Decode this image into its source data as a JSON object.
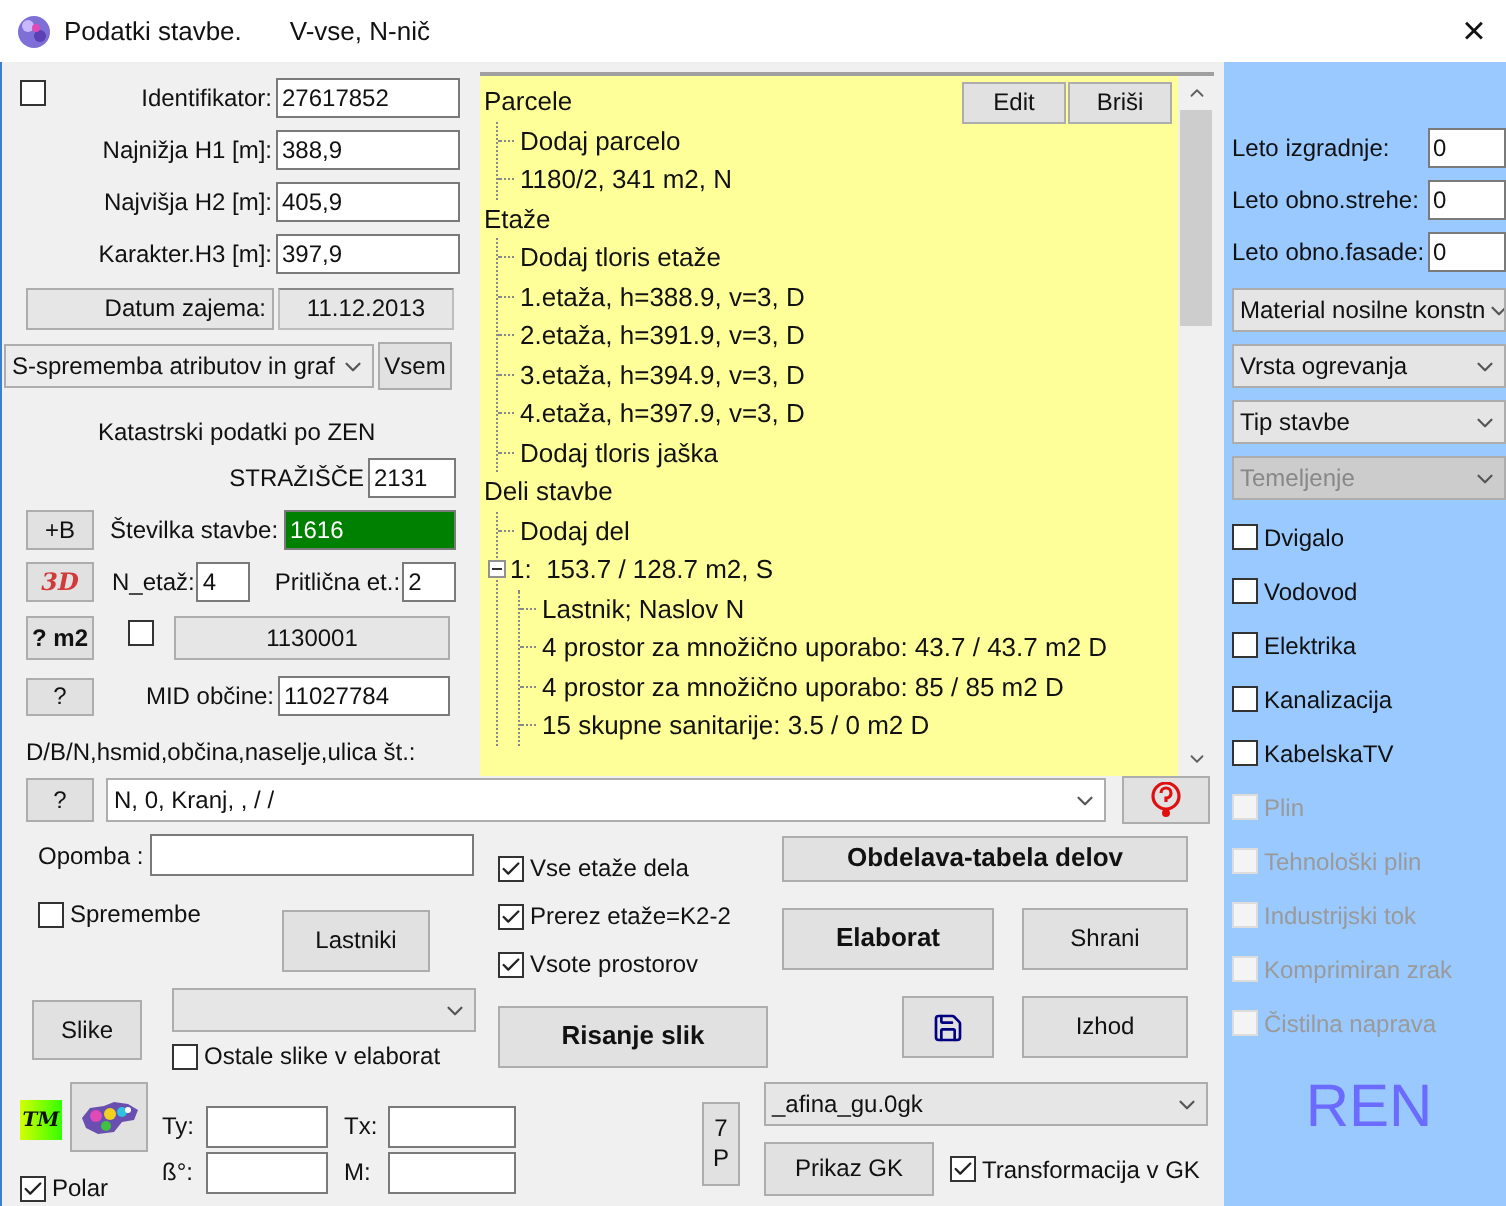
{
  "window": {
    "title": "Podatki stavbe.",
    "subtitle": "V-vse, N-nič",
    "close": "×"
  },
  "identifier": {
    "checked": false,
    "label": "Identifikator:",
    "value": "27617852"
  },
  "heights": [
    {
      "label": "Najnižja H1 [m]:",
      "value": "388,9"
    },
    {
      "label": "Najvišja H2 [m]:",
      "value": "405,9"
    },
    {
      "label": "Karakter.H3 [m]:",
      "value": "397,9"
    }
  ],
  "capture_date": {
    "button": "Datum zajema:",
    "value": "11.12.2013"
  },
  "change_mode": {
    "value": "S-sprememba atributov in graf",
    "button": "Vsem"
  },
  "cadastre": {
    "heading": "Katastrski podatki po ZEN",
    "area_name": "STRAŽIŠČE",
    "area_code": "2131"
  },
  "building_number": {
    "button": "+B",
    "label": "Številka stavbe:",
    "value": "1616"
  },
  "floors": {
    "button": "3D",
    "label": "N_etaž:",
    "value": "4",
    "ground_label": "Pritlična et.:",
    "ground_value": "2"
  },
  "area_row": {
    "button": "? m2",
    "checked": false,
    "code_button": "1130001"
  },
  "municipality": {
    "button": "?",
    "label": "MID občine:",
    "value": "11027784"
  },
  "address_hint": "D/B/N,hsmid,občina,naselje,ulica št.:",
  "address": {
    "button": "?",
    "value": "N, 0, Kranj, , / /"
  },
  "tree": {
    "buttons": [
      "Edit",
      "Briši"
    ],
    "items": [
      {
        "label": "Parcele",
        "children": [
          {
            "label": "Dodaj parcelo"
          },
          {
            "label": "1180/2, 341 m2, N"
          }
        ]
      },
      {
        "label": "Etaže",
        "children": [
          {
            "label": "Dodaj tloris etaže"
          },
          {
            "label": "1.etaža, h=388.9, v=3, D"
          },
          {
            "label": "2.etaža, h=391.9, v=3, D"
          },
          {
            "label": "3.etaža, h=394.9, v=3, D"
          },
          {
            "label": "4.etaža, h=397.9, v=3, D"
          },
          {
            "label": "Dodaj tloris jaška"
          }
        ]
      },
      {
        "label": "Deli stavbe",
        "children": [
          {
            "label": "Dodaj del"
          },
          {
            "label": "1:  153.7 / 128.7 m2, S",
            "expanded": true,
            "children": [
              {
                "label": "Lastnik; Naslov N"
              },
              {
                "label": "4 prostor za množično uporabo: 43.7 / 43.7 m2 D"
              },
              {
                "label": "4 prostor za množično uporabo: 85 / 85 m2 D"
              },
              {
                "label": "15 skupne sanitarije: 3.5 / 0 m2 D"
              }
            ]
          }
        ]
      }
    ]
  },
  "note": {
    "label": "Opomba :"
  },
  "changes": {
    "label": "Spremembe",
    "checked": false
  },
  "options": [
    {
      "label": "Vse etaže dela",
      "checked": true
    },
    {
      "label": "Prerez etaže=K2-2",
      "checked": true
    },
    {
      "label": "Vsote prostorov",
      "checked": true
    }
  ],
  "actions": {
    "table": "Obdelava-tabela delov",
    "owners": "Lastniki",
    "report": "Elaborat",
    "save": "Shrani",
    "pictures": "Slike",
    "draw": "Risanje slik",
    "exit": "Izhod"
  },
  "other_pictures": {
    "label": "Ostale slike v elaborat",
    "checked": false
  },
  "transform": {
    "tm_badge": "TM",
    "ty_label": "Ty:",
    "tx_label": "Tx:",
    "beta_label": "ß°:",
    "m_label": "M:",
    "polar": {
      "label": "Polar",
      "checked": true
    },
    "button_7p": "7\nP",
    "file": "_afina_gu.0gk",
    "show_button": "Prikaz GK",
    "gk": {
      "label": "Transformacija v GK",
      "checked": true
    }
  },
  "right_panel": {
    "years": [
      {
        "label": "Leto izgradnje:",
        "value": "0"
      },
      {
        "label": "Leto obno.strehe:",
        "value": "0"
      },
      {
        "label": "Leto obno.fasade:",
        "value": "0"
      }
    ],
    "dropdowns": [
      {
        "value": "Material nosilne konstn",
        "disabled": false
      },
      {
        "value": "Vrsta ogrevanja",
        "disabled": false
      },
      {
        "value": "Tip stavbe",
        "disabled": false
      },
      {
        "value": "Temeljenje",
        "disabled": true
      }
    ],
    "utilities": [
      {
        "label": "Dvigalo",
        "checked": false,
        "disabled": false
      },
      {
        "label": "Vodovod",
        "checked": false,
        "disabled": false
      },
      {
        "label": "Elektrika",
        "checked": false,
        "disabled": false
      },
      {
        "label": "Kanalizacija",
        "checked": false,
        "disabled": false
      },
      {
        "label": "KabelskaTV",
        "checked": false,
        "disabled": false
      },
      {
        "label": "Plin",
        "checked": false,
        "disabled": true
      },
      {
        "label": "Tehnološki plin",
        "checked": false,
        "disabled": true
      },
      {
        "label": "Industrijski tok",
        "checked": false,
        "disabled": true
      },
      {
        "label": "Komprimiran zrak",
        "checked": false,
        "disabled": true
      },
      {
        "label": "Čistilna naprava",
        "checked": false,
        "disabled": true
      }
    ],
    "logo": "REN"
  }
}
